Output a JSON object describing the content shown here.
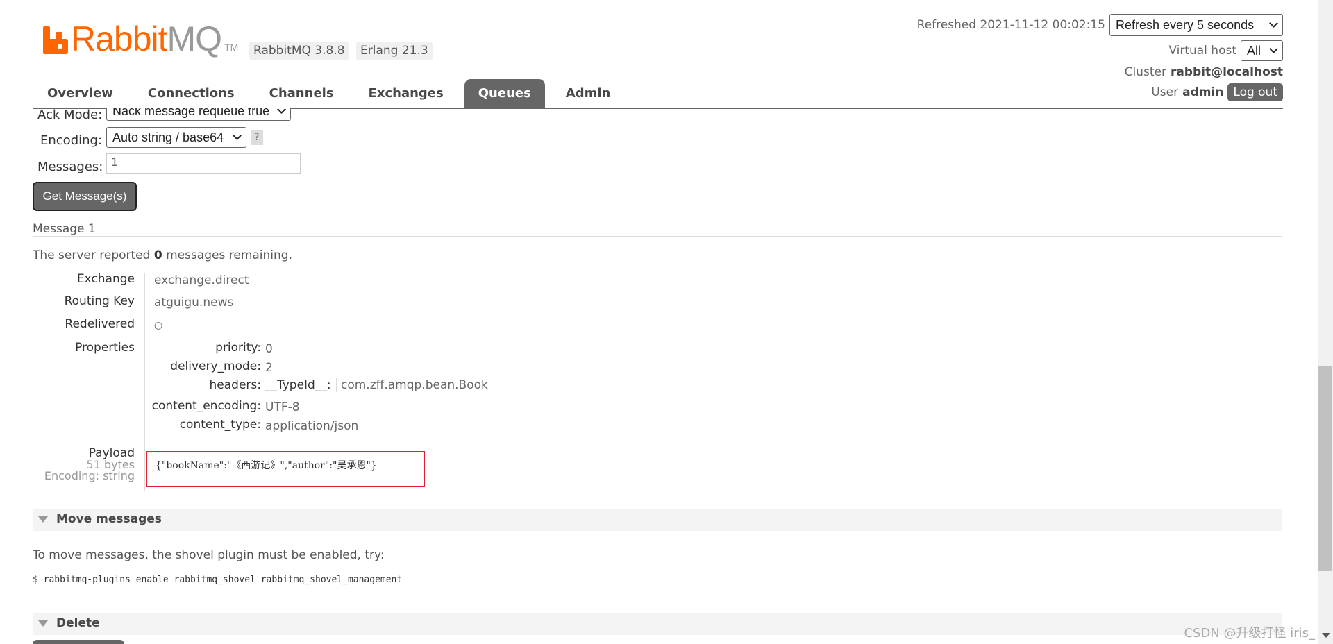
{
  "header": {
    "logo_rabbit": "Rabbit",
    "logo_mq": "MQ",
    "logo_tm": "TM",
    "rabbitmq_version": "RabbitMQ 3.8.8",
    "erlang_version": "Erlang 21.3",
    "refreshed_label": "Refreshed 2021-11-12 00:02:15",
    "refresh_select": "Refresh every 5 seconds",
    "virtual_host_label": "Virtual host",
    "virtual_host_select": "All",
    "cluster_label": "Cluster",
    "cluster_value": "rabbit@localhost",
    "user_label": "User",
    "user_value": "admin",
    "logout": "Log out"
  },
  "tabs": [
    "Overview",
    "Connections",
    "Channels",
    "Exchanges",
    "Queues",
    "Admin"
  ],
  "active_tab": "Queues",
  "get_form": {
    "ack_mode_label": "Ack Mode:",
    "ack_mode_value": "Nack message requeue true",
    "encoding_label": "Encoding:",
    "encoding_value": "Auto string / base64",
    "help": "?",
    "messages_label": "Messages:",
    "messages_value": "1",
    "get_button": "Get Message(s)"
  },
  "message": {
    "title": "Message 1",
    "remaining_prefix": "The server reported",
    "remaining_count": "0",
    "remaining_suffix": "messages remaining.",
    "fields": [
      {
        "key": "Exchange",
        "value": "exchange.direct"
      },
      {
        "key": "Routing Key",
        "value": "atguigu.news"
      },
      {
        "key": "Redelivered",
        "value": "○"
      },
      {
        "key": "Properties",
        "value": ""
      }
    ],
    "properties": [
      {
        "key": "priority:",
        "value": "0"
      },
      {
        "key": "delivery_mode:",
        "value": "2"
      },
      {
        "key": "headers:",
        "header_key": "__TypeId__:",
        "value": "com.zff.amqp.bean.Book"
      },
      {
        "key": "content_encoding:",
        "value": "UTF-8"
      },
      {
        "key": "content_type:",
        "value": "application/json"
      }
    ],
    "payload_label": "Payload",
    "payload_size": "51 bytes",
    "payload_encoding": "Encoding: string",
    "payload_body": "{\"bookName\":\"《西游记》\",\"author\":\"吴承恩\"}"
  },
  "move_section": {
    "title": "Move messages",
    "text": "To move messages, the shovel plugin must be enabled, try:",
    "command": "$ rabbitmq-plugins enable rabbitmq_shovel rabbitmq_shovel_management"
  },
  "delete_section": {
    "title": "Delete"
  },
  "watermark": "CSDN @升级打怪 iris_"
}
